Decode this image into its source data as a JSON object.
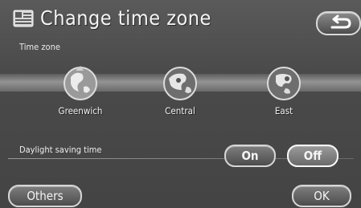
{
  "header": {
    "title": "Change time zone",
    "icon": "time-zone-icon",
    "back_icon": "return-arrow-icon"
  },
  "time_zone": {
    "label": "Time zone",
    "zones": [
      {
        "label": "Greenwich",
        "icon": "globe-icon"
      },
      {
        "label": "Central",
        "icon": "globe-icon"
      },
      {
        "label": "East",
        "icon": "globe-icon"
      }
    ]
  },
  "dst": {
    "label": "Daylight saving time",
    "on_label": "On",
    "off_label": "Off",
    "selected": "Off"
  },
  "footer": {
    "others_label": "Others",
    "ok_label": "OK"
  },
  "colors": {
    "background": "#4b4b4b",
    "button_border": "#d6d6d6",
    "text": "#ffffff"
  }
}
